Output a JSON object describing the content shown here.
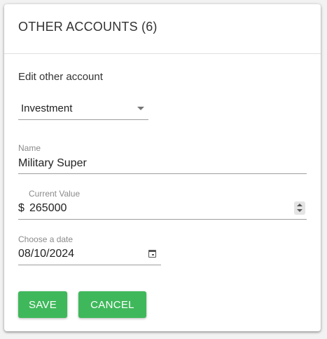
{
  "dialog": {
    "title": "OTHER ACCOUNTS (6)",
    "subtitle": "Edit other account"
  },
  "account_type": {
    "selected": "Investment"
  },
  "name_field": {
    "label": "Name",
    "value": "Military Super"
  },
  "value_field": {
    "label": "Current Value",
    "prefix": "$",
    "value": "265000"
  },
  "date_field": {
    "label": "Choose a date",
    "value": "08/10/2024",
    "icon": "calendar-icon"
  },
  "buttons": {
    "save": "SAVE",
    "cancel": "CANCEL"
  },
  "colors": {
    "primary_button": "#3fb85b"
  }
}
